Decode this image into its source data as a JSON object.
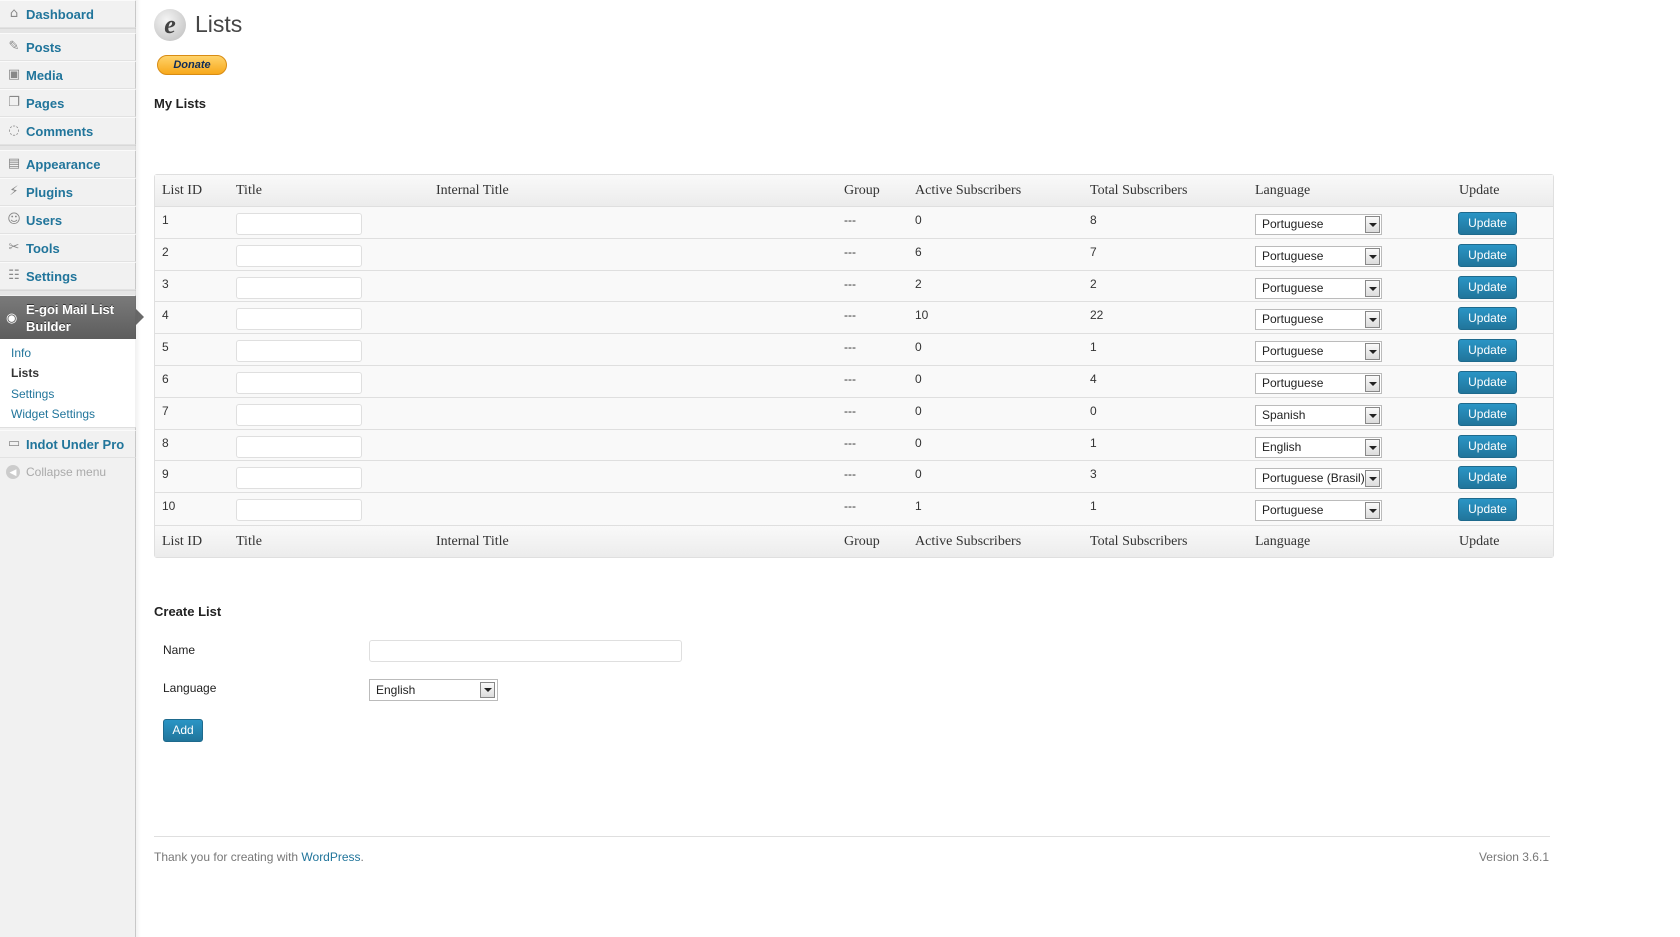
{
  "sidebar": {
    "items": [
      {
        "label": "Dashboard",
        "icon": "dashboard-icon"
      },
      {
        "label": "Posts",
        "icon": "pushpin-icon"
      },
      {
        "label": "Media",
        "icon": "media-icon"
      },
      {
        "label": "Pages",
        "icon": "pages-icon"
      },
      {
        "label": "Comments",
        "icon": "comment-icon"
      },
      {
        "label": "Appearance",
        "icon": "appearance-icon"
      },
      {
        "label": "Plugins",
        "icon": "plugin-icon"
      },
      {
        "label": "Users",
        "icon": "users-icon"
      },
      {
        "label": "Tools",
        "icon": "tools-icon"
      },
      {
        "label": "Settings",
        "icon": "settings-icon"
      }
    ],
    "active": {
      "label": "E-goi Mail List Builder",
      "icon": "egoi-icon"
    },
    "submenu": [
      "Info",
      "Lists",
      "Settings",
      "Widget Settings"
    ],
    "submenu_current": "Lists",
    "extra": {
      "label": "Indot Under Pro",
      "icon": "monitor-icon"
    },
    "collapse": "Collapse menu"
  },
  "page": {
    "title": "Lists",
    "donate": "Donate",
    "section_title": "My Lists"
  },
  "table": {
    "headers": [
      "List ID",
      "Title",
      "Internal Title",
      "Group",
      "Active Subscribers",
      "Total Subscribers",
      "Language",
      "Update"
    ],
    "rows": [
      {
        "id": "1",
        "group": "---",
        "active": "0",
        "total": "8",
        "language": "Portuguese",
        "button": "Update"
      },
      {
        "id": "2",
        "group": "---",
        "active": "6",
        "total": "7",
        "language": "Portuguese",
        "button": "Update"
      },
      {
        "id": "3",
        "group": "---",
        "active": "2",
        "total": "2",
        "language": "Portuguese",
        "button": "Update"
      },
      {
        "id": "4",
        "group": "---",
        "active": "10",
        "total": "22",
        "language": "Portuguese",
        "button": "Update"
      },
      {
        "id": "5",
        "group": "---",
        "active": "0",
        "total": "1",
        "language": "Portuguese",
        "button": "Update"
      },
      {
        "id": "6",
        "group": "---",
        "active": "0",
        "total": "4",
        "language": "Portuguese",
        "button": "Update"
      },
      {
        "id": "7",
        "group": "---",
        "active": "0",
        "total": "0",
        "language": "Spanish",
        "button": "Update"
      },
      {
        "id": "8",
        "group": "---",
        "active": "0",
        "total": "1",
        "language": "English",
        "button": "Update"
      },
      {
        "id": "9",
        "group": "---",
        "active": "0",
        "total": "3",
        "language": "Portuguese (Brasil)",
        "button": "Update"
      },
      {
        "id": "10",
        "group": "---",
        "active": "1",
        "total": "1",
        "language": "Portuguese",
        "button": "Update"
      }
    ]
  },
  "create": {
    "title": "Create List",
    "name_label": "Name",
    "name_value": "",
    "language_label": "Language",
    "language_value": "English",
    "add_label": "Add"
  },
  "footer": {
    "thanks_prefix": "Thank you for creating with ",
    "thanks_link": "WordPress",
    "thanks_suffix": ".",
    "version": "Version 3.6.1"
  },
  "colors": {
    "link": "#21759b",
    "button": "#21759b",
    "active_menu": "#6a6a6a"
  }
}
